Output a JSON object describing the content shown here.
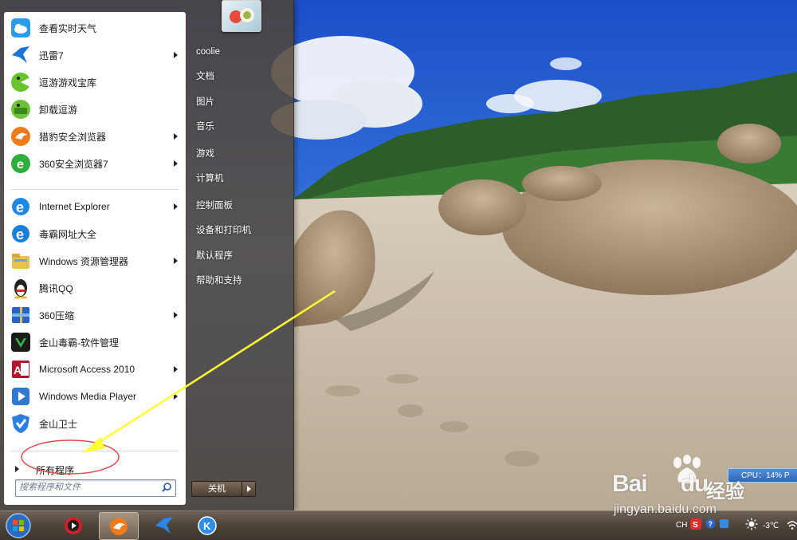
{
  "start_menu": {
    "programs": [
      {
        "label": "查看实时天气",
        "icon": "weather-icon",
        "arrow": false
      },
      {
        "label": "迅雷7",
        "icon": "xunlei-bird-icon",
        "arrow": true
      },
      {
        "label": "逗游游戏宝库",
        "icon": "game-treasury-icon",
        "arrow": false
      },
      {
        "label": "卸载逗游",
        "icon": "uninstall-game-icon",
        "arrow": false
      },
      {
        "label": "猎豹安全浏览器",
        "icon": "cheetah-browser-icon",
        "arrow": true
      },
      {
        "label": "360安全浏览器7",
        "icon": "360-browser-icon",
        "arrow": true
      },
      {
        "label": "Internet Explorer",
        "icon": "internet-explorer-icon",
        "arrow": true
      },
      {
        "label": "毒霸网址大全",
        "icon": "duba-url-icon",
        "arrow": false
      },
      {
        "label": "Windows 资源管理器",
        "icon": "windows-explorer-icon",
        "arrow": true
      },
      {
        "label": "腾讯QQ",
        "icon": "qq-penguin-icon",
        "arrow": false
      },
      {
        "label": "360压缩",
        "icon": "360-zip-icon",
        "arrow": true
      },
      {
        "label": "金山毒霸-软件管理",
        "icon": "software-manager-icon",
        "arrow": false
      },
      {
        "label": "Microsoft Access 2010",
        "icon": "access-icon",
        "arrow": true
      },
      {
        "label": "Windows Media Player",
        "icon": "media-player-icon",
        "arrow": true
      },
      {
        "label": "金山卫士",
        "icon": "kingsoft-guard-icon",
        "arrow": false
      }
    ],
    "all_programs": "所有程序",
    "search_placeholder": "搜索程序和文件",
    "right_links": [
      "coolie",
      "文档",
      "图片",
      "音乐",
      "游戏",
      "计算机",
      "控制面板",
      "设备和打印机",
      "默认程序",
      "帮助和支持"
    ],
    "shutdown_label": "关机"
  },
  "taskbar": {
    "items": [
      "start-orb",
      "media-player-red-icon",
      "cheetah-browser-icon",
      "xunlei-bird-icon",
      "k-player-icon"
    ],
    "tray_lang": "CH",
    "temperature": "-3℃"
  },
  "overlay": {
    "cpu_text": "CPU：14%  P",
    "watermark_brand": "Bai",
    "watermark_brand2": "du",
    "watermark_sub": "经验",
    "watermark_url": "jingyan.baidu.com"
  },
  "colors": {
    "accent_blue": "#2d67b8",
    "annotation_yellow": "#ffff33",
    "highlight_red": "#e04a4a"
  }
}
